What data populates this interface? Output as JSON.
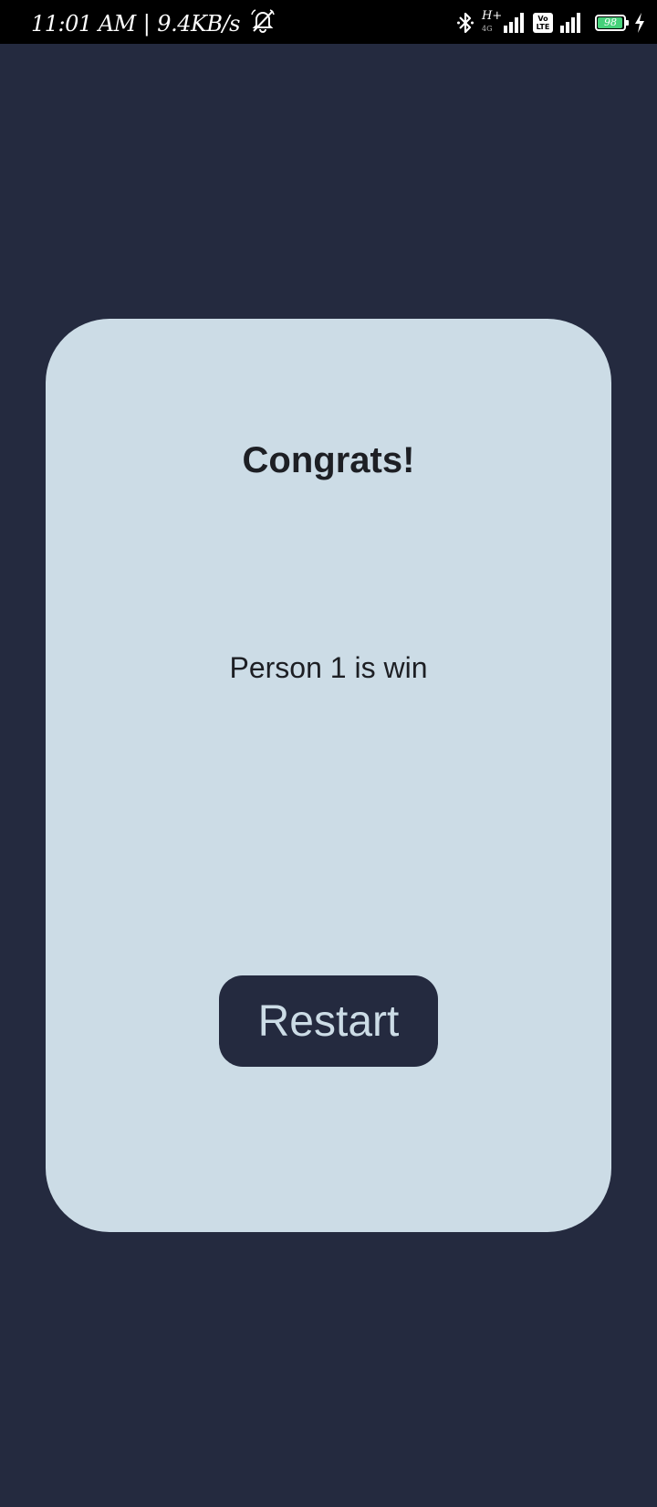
{
  "status_bar": {
    "time": "11:01 AM",
    "separator": "|",
    "network_speed": "9.4KB/s",
    "network_type_top": "H+",
    "network_type_bottom": "4G",
    "volte_line1": "Vo",
    "volte_line2": "LTE",
    "battery_level": "98",
    "battery_fill_color": "#45d17a",
    "icons": [
      "mute-alarm-icon",
      "bluetooth-icon",
      "signal-icon",
      "volte-icon",
      "signal-icon",
      "battery-icon",
      "charging-icon"
    ]
  },
  "dialog": {
    "title": "Congrats!",
    "message": "Person 1 is win",
    "restart_label": "Restart"
  },
  "colors": {
    "background": "#242a3f",
    "card": "#ccdce6",
    "text": "#1d1f24",
    "button": "#242a3f",
    "button_text": "#ccdce6"
  }
}
